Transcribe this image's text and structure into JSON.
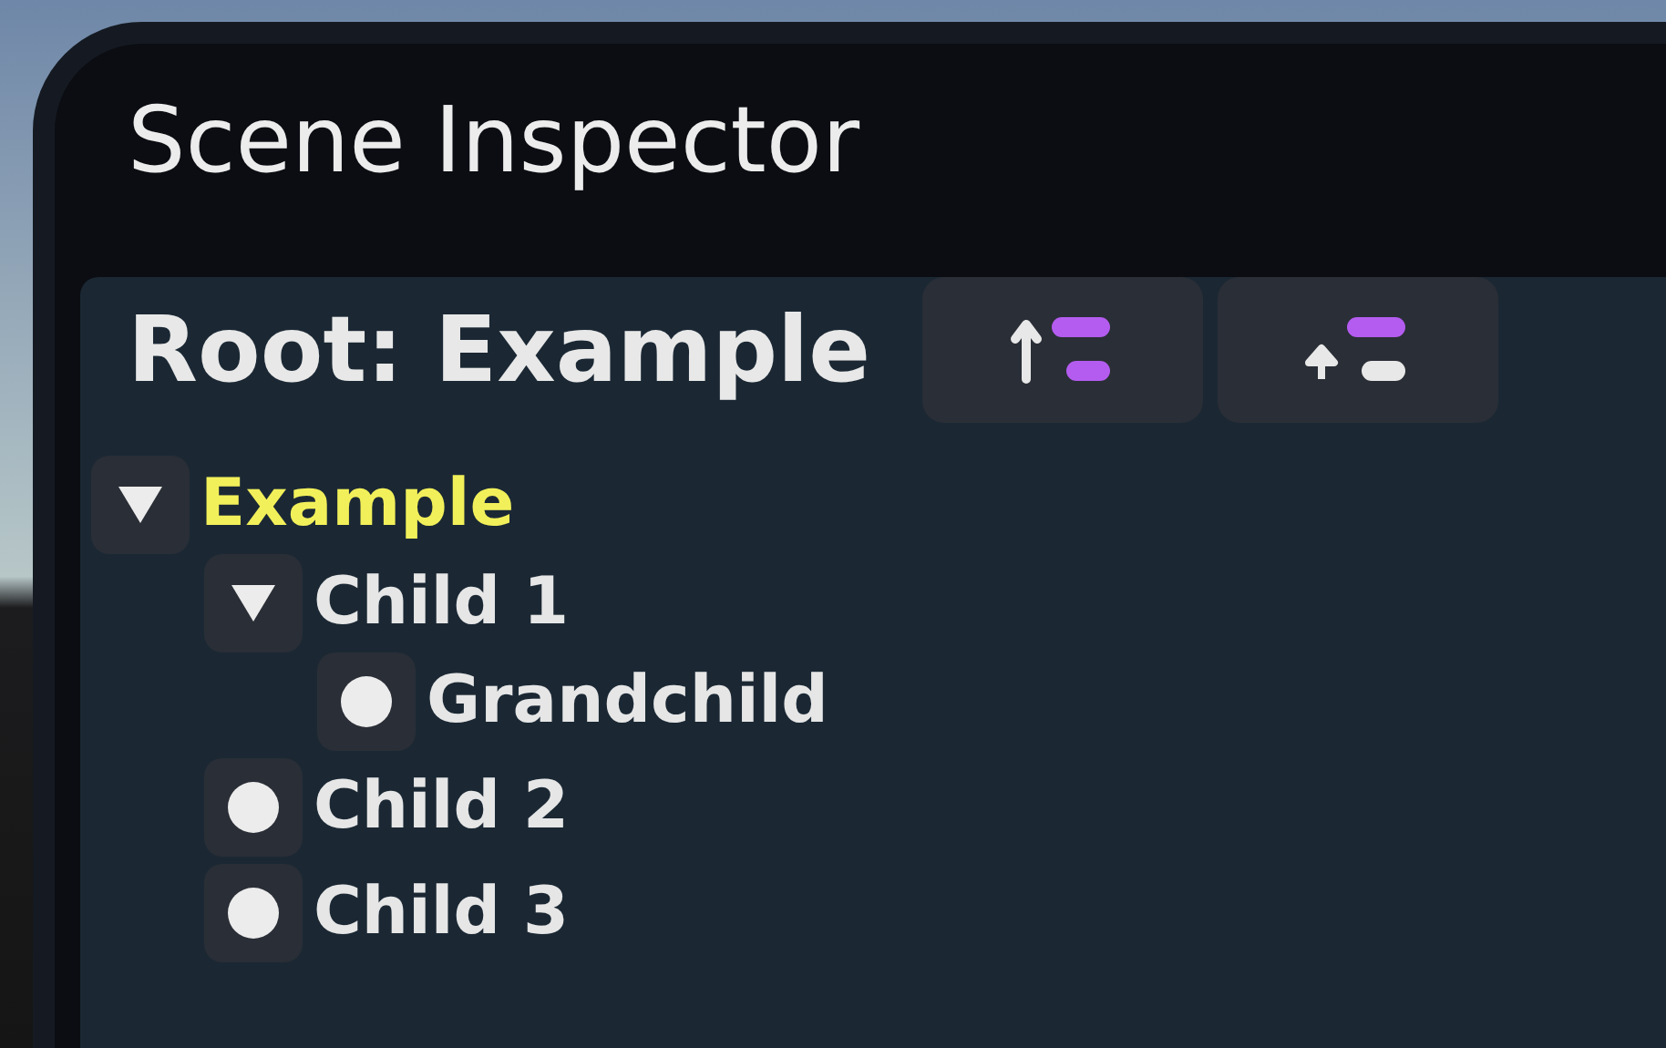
{
  "window": {
    "title": "Scene Inspector"
  },
  "root": {
    "label": "Root: Example"
  },
  "toolbar": [
    {
      "kind": "collapse-all"
    },
    {
      "kind": "collapse-level"
    }
  ],
  "tree": [
    {
      "label": "Example",
      "selected": true,
      "expanded": true,
      "children": [
        {
          "label": "Child 1",
          "selected": false,
          "expanded": true,
          "children": [
            {
              "label": "Grandchild",
              "selected": false
            }
          ]
        },
        {
          "label": "Child 2",
          "selected": false
        },
        {
          "label": "Child 3",
          "selected": false
        }
      ]
    }
  ]
}
